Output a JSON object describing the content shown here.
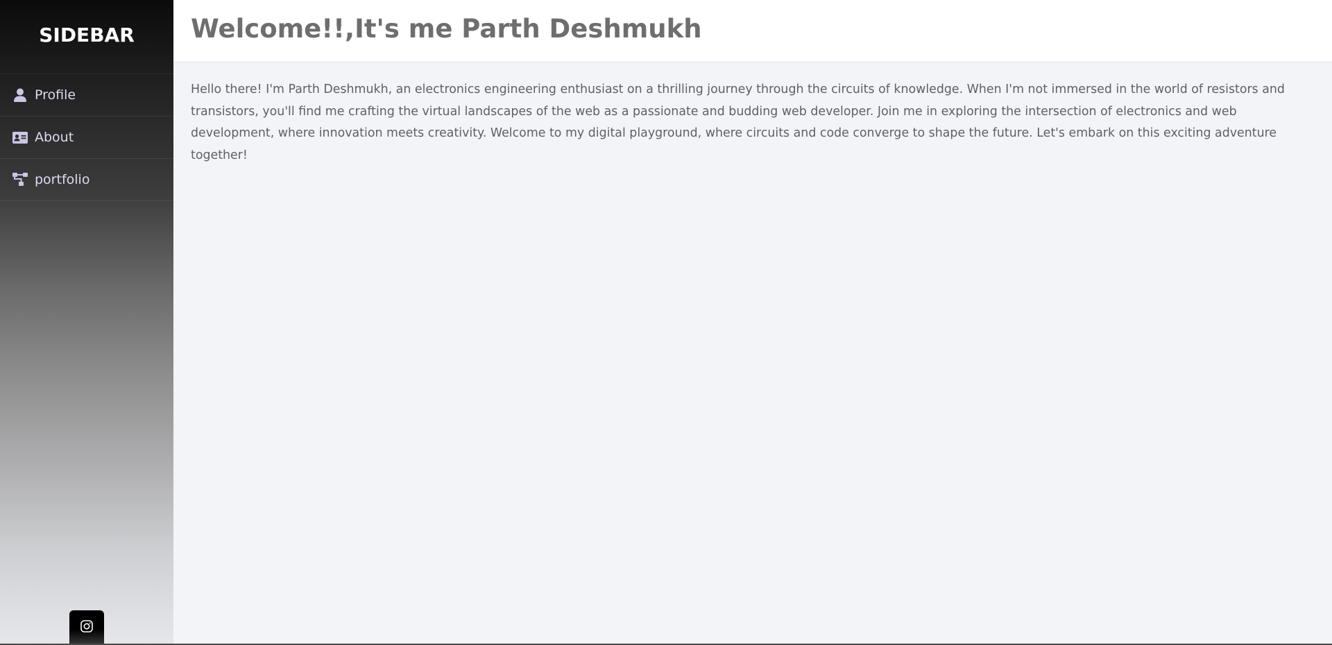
{
  "sidebar": {
    "title": "SIDEBAR",
    "items": [
      {
        "label": "Profile",
        "icon": "user-icon"
      },
      {
        "label": "About",
        "icon": "id-card-icon"
      },
      {
        "label": "portfolio",
        "icon": "sitemap-icon"
      }
    ],
    "social": {
      "icon": "instagram-icon"
    }
  },
  "header": {
    "title": "Welcome!!,It's me Parth Deshmukh"
  },
  "main": {
    "intro": "Hello there! I'm Parth Deshmukh, an electronics engineering enthusiast on a thrilling journey through the circuits of knowledge. When I'm not immersed in the world of resistors and transistors, you'll find me crafting the virtual landscapes of the web as a passionate and budding web developer. Join me in exploring the intersection of electronics and web development, where innovation meets creativity. Welcome to my digital playground, where circuits and code converge to shape the future. Let's embark on this exciting adventure together!"
  },
  "colors": {
    "nav_text": "#dcdbf0",
    "title_text": "#6e6e6e",
    "body_text": "#5f5f66",
    "main_bg": "#f3f4f8"
  }
}
